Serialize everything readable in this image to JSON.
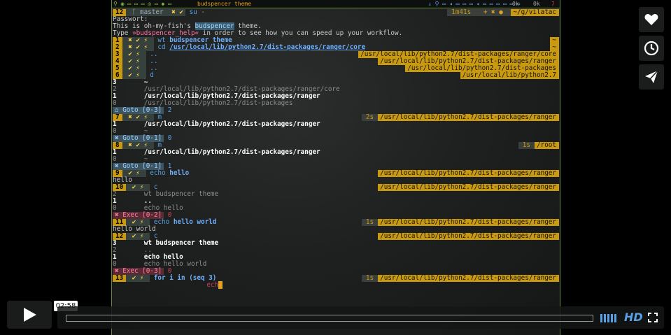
{
  "player": {
    "time_tooltip": "02:58",
    "hd_label": "HD",
    "play_icon": "play-icon",
    "like_icon": "heart-icon",
    "later_icon": "clock-icon",
    "share_icon": "paper-plane-icon"
  },
  "topbar": {
    "title": "budspencer theme",
    "stat1": "0k",
    "stat2": "0k",
    "stat3": "7"
  },
  "terminal": {
    "header": {
      "num": "12",
      "branch": "master",
      "flags": "✖ ✔",
      "cmd": "su -",
      "time": "1m41s",
      "path": "~/g/vilatac"
    },
    "password": "Passwort:",
    "intro1_a": "This is oh-my-fish's ",
    "intro1_b": "budspencer",
    "intro1_c": " theme.",
    "intro2_a": "Type ",
    "intro2_b": "»budspencer_help«",
    "intro2_c": " in order to see how you can speed up your workflow.",
    "rows": [
      {
        "num": "1",
        "flags": "✖ ✔ ⚡",
        "cmd": "wt",
        "arg": "budspencer theme",
        "right": "~"
      },
      {
        "num": "2",
        "flags": "✖ ✔ ⚡",
        "cmd": "cd",
        "arg": "/usr/local/lib/python2.7/dist-packages/ranger/core",
        "right": "~"
      },
      {
        "num": "3",
        "flags": "✔ ⚡",
        "cmd": "..",
        "arg": "",
        "right": "/usr/local/lib/python2.7/dist-packages/ranger/core"
      },
      {
        "num": "4",
        "flags": "✔ ⚡",
        "cmd": "..",
        "arg": "",
        "right": "/usr/local/lib/python2.7/dist-packages/ranger"
      },
      {
        "num": "5",
        "flags": "✔ ⚡",
        "cmd": "..",
        "arg": "",
        "right": "/usr/local/lib/python2.7/dist-packages"
      },
      {
        "num": "6",
        "flags": "✔ ⚡",
        "cmd": "d",
        "arg": "",
        "right": "/usr/local/lib/python2.7"
      }
    ],
    "dirlist1": [
      {
        "n": "3",
        "p": "~"
      },
      {
        "n": "2",
        "p": "/usr/local/lib/python2.7/dist-packages/ranger/core"
      },
      {
        "n": "1",
        "p": "/usr/local/lib/python2.7/dist-packages/ranger"
      },
      {
        "n": "0",
        "p": "/usr/local/lib/python2.7/dist-packages"
      }
    ],
    "goto1": {
      "label": "⌂ Goto [0-3]",
      "val": "2"
    },
    "row7": {
      "num": "7",
      "flags": "✖ ✔ ⚡",
      "cmd": "m",
      "time": "2s",
      "right": "/usr/local/lib/python2.7/dist-packages/ranger"
    },
    "m1": [
      {
        "n": "1",
        "p": "/usr/local/lib/python2.7/dist-packages/ranger"
      },
      {
        "n": "0",
        "p": "~"
      }
    ],
    "goto2": {
      "label": "✖ Goto [0-1]",
      "val": "0"
    },
    "row8": {
      "num": "8",
      "flags": "✖ ✔ ⚡",
      "cmd": "m",
      "time": "1s",
      "right": "/root"
    },
    "m2": [
      {
        "n": "1",
        "p": "/usr/local/lib/python2.7/dist-packages/ranger"
      },
      {
        "n": "0",
        "p": "~"
      }
    ],
    "goto3": {
      "label": "✖ Goto [0-1]",
      "val": "1"
    },
    "row9": {
      "num": "9",
      "flags": "✔ ⚡",
      "cmd": "echo",
      "arg": "hello",
      "right": "/usr/local/lib/python2.7/dist-packages/ranger"
    },
    "out9": "hello",
    "row10": {
      "num": "10",
      "flags": "✔ ⚡",
      "cmd": "c",
      "right": "/usr/local/lib/python2.7/dist-packages/ranger"
    },
    "c1": [
      {
        "n": "2",
        "p": "wt budspencer theme"
      },
      {
        "n": "1",
        "p": ".."
      },
      {
        "n": "0",
        "p": "echo hello"
      }
    ],
    "exec1": {
      "label": "✖ Exec [0-2]",
      "val": "0"
    },
    "row11": {
      "num": "11",
      "flags": "✔ ⚡",
      "cmd": "echo",
      "arg": "hello world",
      "time": "1s",
      "right": "/usr/local/lib/python2.7/dist-packages/ranger"
    },
    "out11": "hello world",
    "row12": {
      "num": "12",
      "flags": "✔ ⚡",
      "cmd": "c",
      "right": "/usr/local/lib/python2.7/dist-packages/ranger"
    },
    "c2": [
      {
        "n": "3",
        "p": "wt budspencer theme"
      },
      {
        "n": "2",
        "p": ".."
      },
      {
        "n": "1",
        "p": "echo hello"
      },
      {
        "n": "0",
        "p": "echo hello world"
      }
    ],
    "exec2": {
      "label": "✖ Exec [0-3]",
      "val": "0"
    },
    "row13": {
      "num": "13",
      "flags": "✔ ⚡",
      "cmd": "for",
      "arg": "i in (seq 3)",
      "time": "1s",
      "right": "/usr/local/lib/python2.7/dist-packages/ranger"
    },
    "typing": "ech"
  }
}
